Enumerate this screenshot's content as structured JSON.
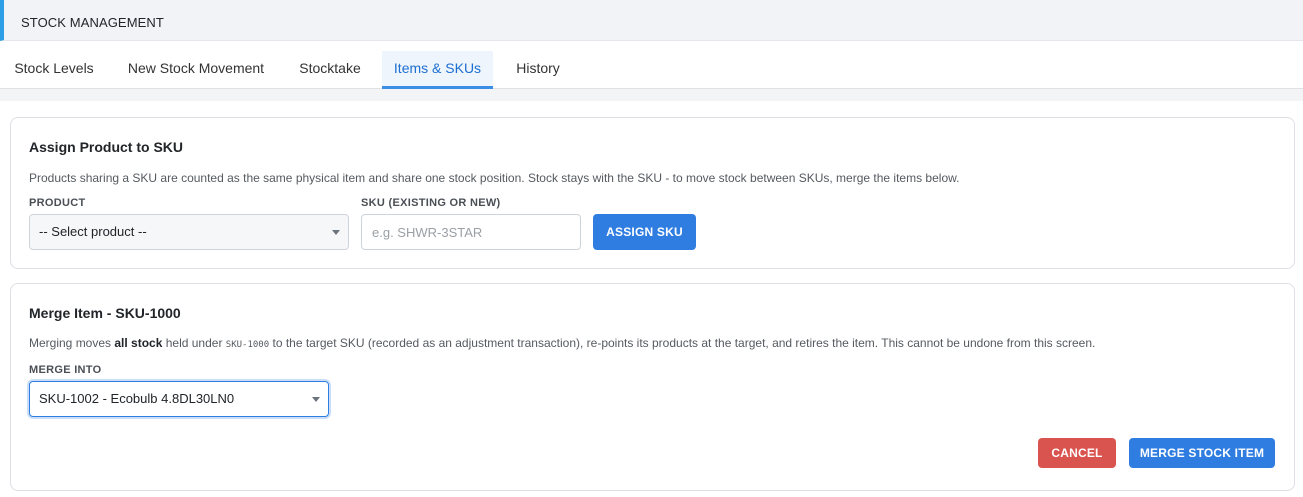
{
  "header": {
    "title": "STOCK MANAGEMENT"
  },
  "tabs": [
    {
      "label": "Stock Levels",
      "active": false
    },
    {
      "label": "New Stock Movement",
      "active": false
    },
    {
      "label": "Stocktake",
      "active": false
    },
    {
      "label": "Items & SKUs",
      "active": true
    },
    {
      "label": "History",
      "active": false
    }
  ],
  "assign": {
    "title": "Assign Product to SKU",
    "description": "Products sharing a SKU are counted as the same physical item and share one stock position. Stock stays with the SKU - to move stock between SKUs, merge the items below.",
    "product_label": "PRODUCT",
    "product_selected": "-- Select product --",
    "sku_label": "SKU (EXISTING OR NEW)",
    "sku_placeholder": "e.g. SHWR-3STAR",
    "sku_value": "",
    "assign_button": "ASSIGN SKU"
  },
  "merge": {
    "title": "Merge Item - SKU-1000",
    "desc_prefix": "Merging moves ",
    "desc_bold": "all stock",
    "desc_mid": " held under ",
    "desc_code": "SKU-1000",
    "desc_suffix": " to the target SKU (recorded as an adjustment transaction), re-points its products at the target, and retires the item. This cannot be undone from this screen.",
    "merge_into_label": "MERGE INTO",
    "merge_into_selected": "SKU-1002 - Ecobulb 4.8DL30LN0",
    "cancel_button": "CANCEL",
    "merge_button": "MERGE STOCK ITEM"
  },
  "colors": {
    "accent": "#2f7de1",
    "danger": "#d9534f",
    "header_bar": "#2e9ee6"
  }
}
